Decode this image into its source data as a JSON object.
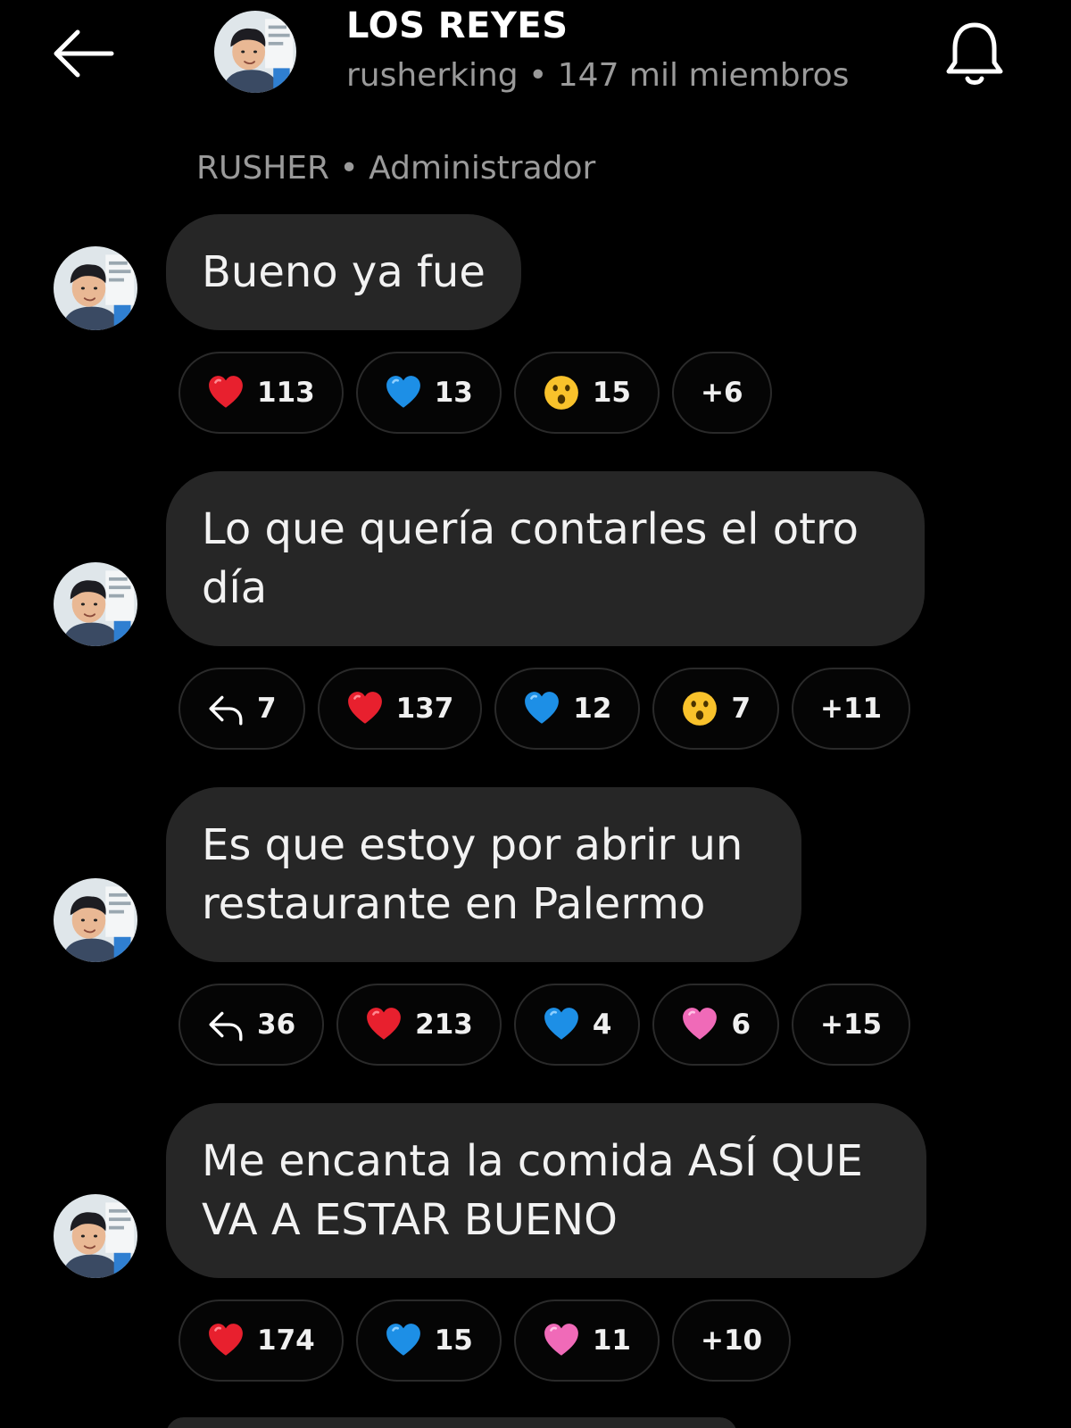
{
  "header": {
    "title": "LOS REYES",
    "subtitle": "rusherking • 147 mil miembros"
  },
  "sender": {
    "line": "RUSHER • Administrador"
  },
  "messages": [
    {
      "text": "Bueno ya fue",
      "reactions": [
        {
          "type": "red-heart",
          "count": "113"
        },
        {
          "type": "blue-heart",
          "count": "13"
        },
        {
          "type": "hushed-face",
          "count": "15"
        },
        {
          "type": "more",
          "count": "+6"
        }
      ]
    },
    {
      "text": "Lo que quería contarles el otro día",
      "reactions": [
        {
          "type": "reply",
          "count": "7"
        },
        {
          "type": "red-heart",
          "count": "137"
        },
        {
          "type": "blue-heart",
          "count": "12"
        },
        {
          "type": "hushed-face",
          "count": "7"
        },
        {
          "type": "more",
          "count": "+11"
        }
      ]
    },
    {
      "text": "Es que estoy por abrir un restaurante en Palermo",
      "reactions": [
        {
          "type": "reply",
          "count": "36"
        },
        {
          "type": "red-heart",
          "count": "213"
        },
        {
          "type": "blue-heart",
          "count": "4"
        },
        {
          "type": "pink-heart",
          "count": "6"
        },
        {
          "type": "more",
          "count": "+15"
        }
      ]
    },
    {
      "text": "Me encanta la comida ASÍ QUE VA A ESTAR BUENO",
      "reactions": [
        {
          "type": "red-heart",
          "count": "174"
        },
        {
          "type": "blue-heart",
          "count": "15"
        },
        {
          "type": "pink-heart",
          "count": "11"
        },
        {
          "type": "more",
          "count": "+10"
        }
      ]
    }
  ],
  "icons": {
    "back": "arrow-left-icon",
    "notifications": "bell-icon"
  },
  "colors": {
    "background": "#000000",
    "bubble": "#262626",
    "muted_text": "#9a9a9a",
    "red_heart": "#e8202e",
    "blue_heart": "#1d8fe6",
    "pink_heart": "#f06ab8",
    "hushed_face": "#f9c22b"
  }
}
